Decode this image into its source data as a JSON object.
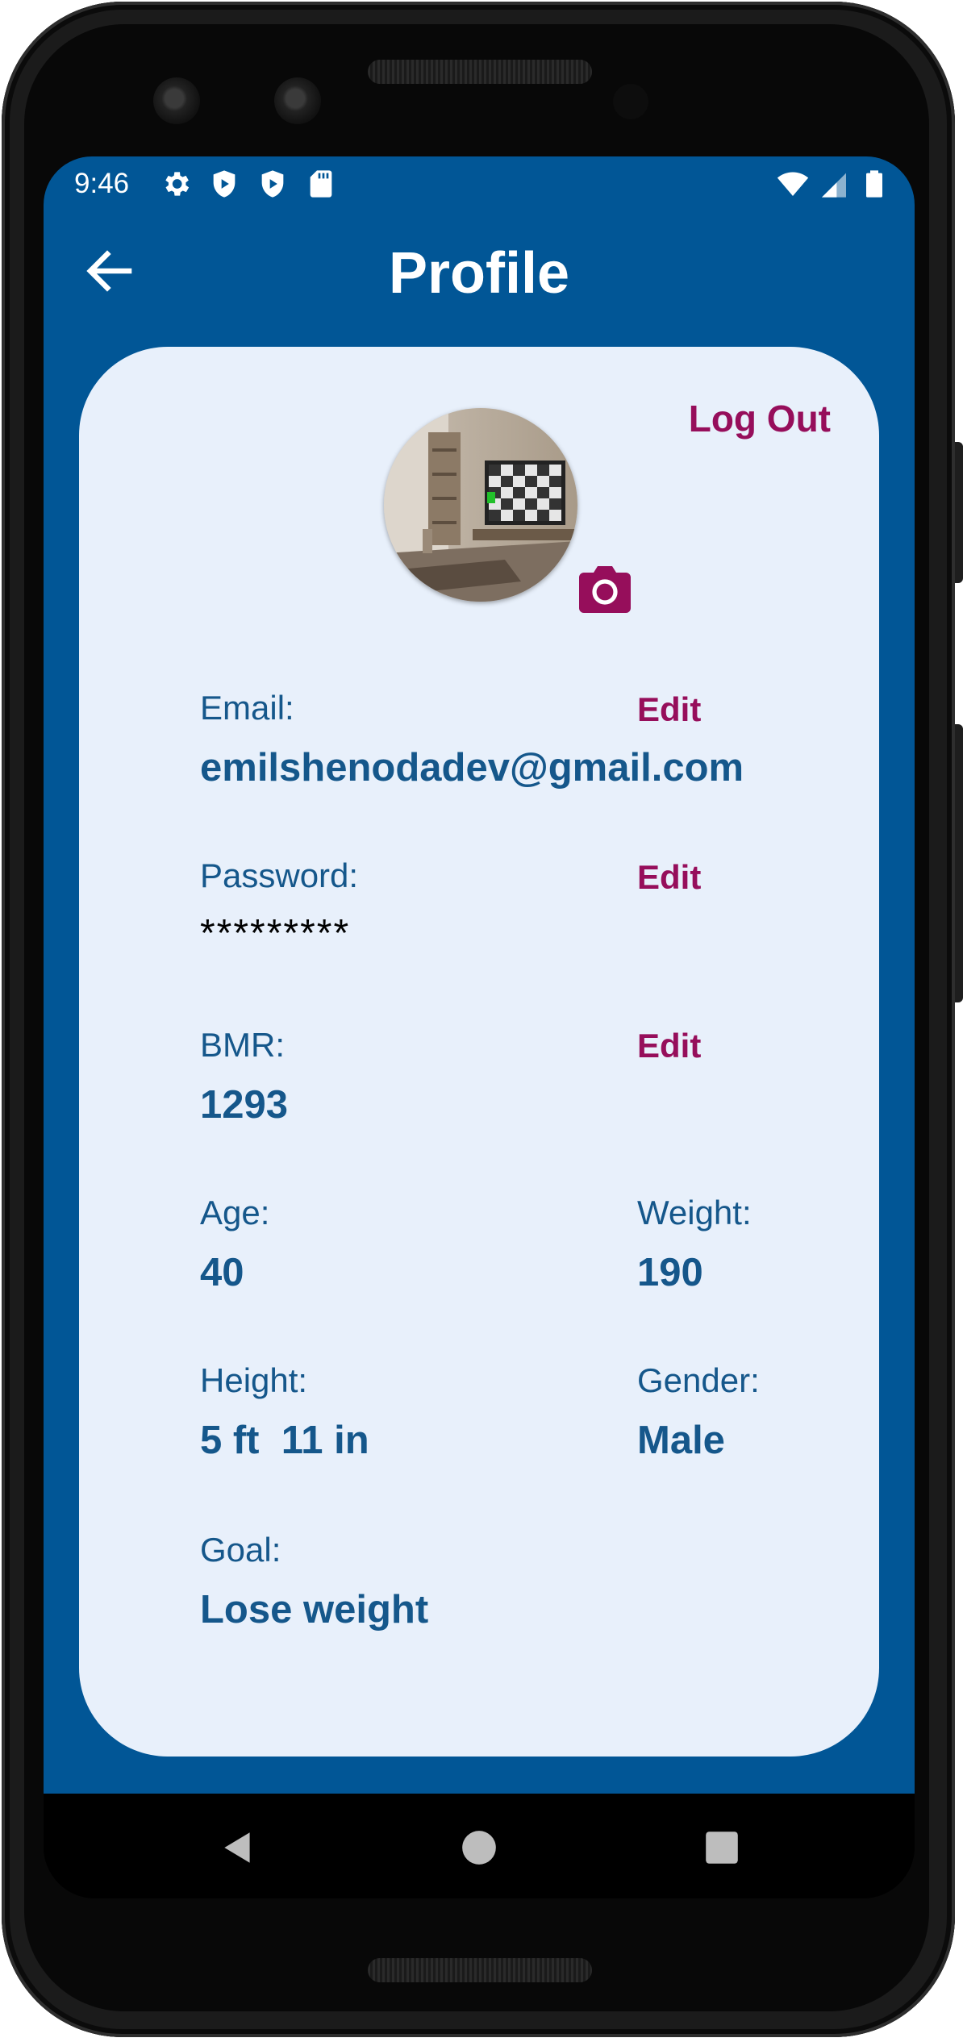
{
  "status_bar": {
    "time": "9:46"
  },
  "header": {
    "title": "Profile",
    "back_icon": "arrow-left-icon"
  },
  "profile": {
    "logout_label": "Log Out",
    "camera_icon": "camera-icon",
    "fields": {
      "email": {
        "label": "Email:",
        "value": "emilshenodadev@gmail.com",
        "edit": "Edit"
      },
      "password": {
        "label": "Password:",
        "value": "*********",
        "edit": "Edit"
      },
      "bmr": {
        "label": "BMR:",
        "value": "1293",
        "edit": "Edit"
      },
      "age": {
        "label": "Age:",
        "value": "40"
      },
      "weight": {
        "label": "Weight:",
        "value": "190"
      },
      "height": {
        "label": "Height:",
        "value": "5 ft  11 in"
      },
      "gender": {
        "label": "Gender:",
        "value": "Male"
      },
      "goal": {
        "label": "Goal:",
        "value": "Lose weight"
      }
    }
  },
  "colors": {
    "app_bar": "#015696",
    "card": "#e8f0fb",
    "text": "#15578b",
    "accent": "#960e5b"
  }
}
